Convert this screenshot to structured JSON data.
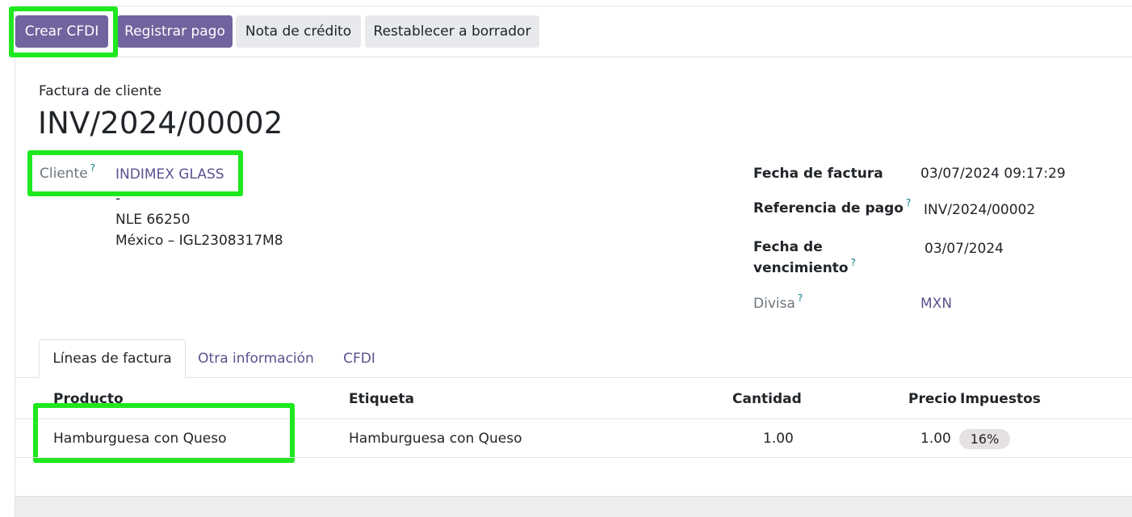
{
  "actions": {
    "crear_cfdi": "Crear CFDI",
    "registrar_pago": "Registrar pago",
    "nota_credito": "Nota de crédito",
    "restablecer": "Restablecer a borrador"
  },
  "document": {
    "subtitle": "Factura de cliente",
    "number": "INV/2024/00002"
  },
  "customer": {
    "label": "Cliente",
    "help": "?",
    "name": "INDIMEX GLASS",
    "address_line1": "-",
    "address_line2": "NLE 66250",
    "address_line3": "México – IGL2308317M8"
  },
  "details": {
    "fecha_factura_label": "Fecha de factura",
    "fecha_factura_value": "03/07/2024 09:17:29",
    "referencia_label": "Referencia de pago",
    "referencia_help": "?",
    "referencia_value": "INV/2024/00002",
    "vencimiento_label_1": "Fecha de",
    "vencimiento_label_2": "vencimiento",
    "vencimiento_help": "?",
    "vencimiento_value": "03/07/2024",
    "divisa_label": "Divisa",
    "divisa_help": "?",
    "divisa_value": "MXN"
  },
  "tabs": [
    {
      "label": "Líneas de factura",
      "active": true
    },
    {
      "label": "Otra información",
      "active": false
    },
    {
      "label": "CFDI",
      "active": false
    }
  ],
  "table": {
    "headers": [
      "Producto",
      "Etiqueta",
      "Cantidad",
      "Precio",
      "Impuestos"
    ],
    "rows": [
      {
        "producto": "Hamburguesa con Queso",
        "etiqueta": "Hamburguesa con Queso",
        "cantidad": "1.00",
        "precio": "1.00",
        "impuestos": "16%"
      }
    ]
  },
  "colors": {
    "primary": "#71639e",
    "link": "#5d4f8e",
    "highlight": "#1ee81e",
    "help": "#017e84"
  }
}
